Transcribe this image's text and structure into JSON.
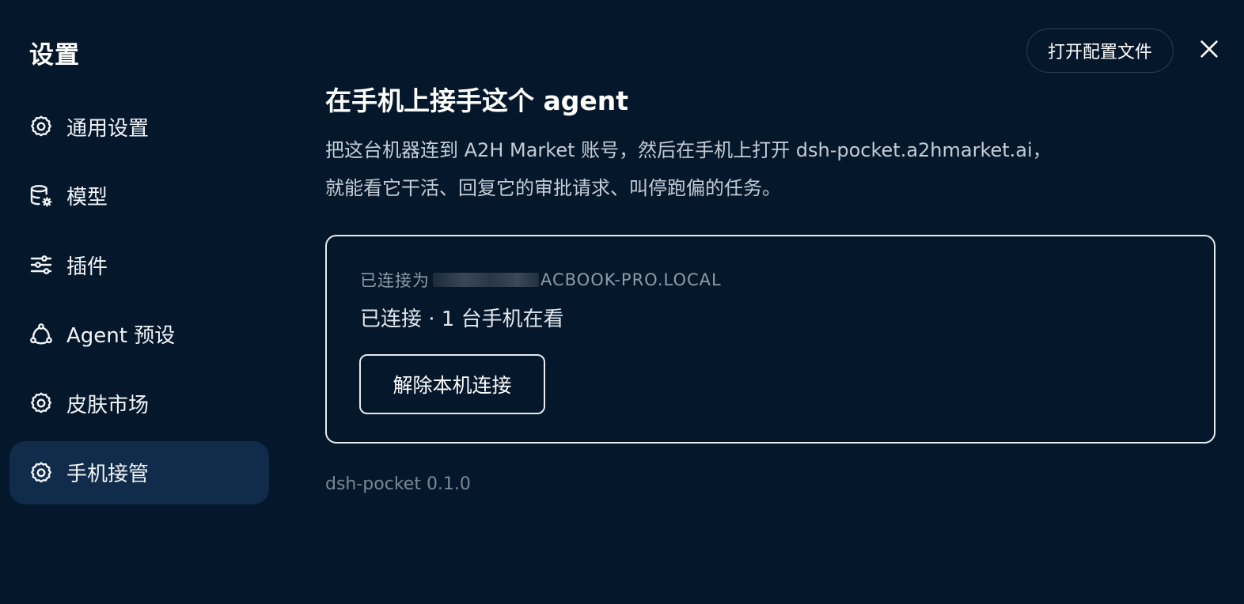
{
  "sidebar": {
    "title": "设置",
    "items": [
      {
        "label": "通用设置",
        "icon": "gear-icon",
        "active": false
      },
      {
        "label": "模型",
        "icon": "database-gear-icon",
        "active": false
      },
      {
        "label": "插件",
        "icon": "sliders-icon",
        "active": false
      },
      {
        "label": "Agent 预设",
        "icon": "agent-nodes-icon",
        "active": false
      },
      {
        "label": "皮肤市场",
        "icon": "gear-icon",
        "active": false
      },
      {
        "label": "手机接管",
        "icon": "gear-icon",
        "active": true
      }
    ]
  },
  "header": {
    "open_config_label": "打开配置文件",
    "close_icon": "close-icon"
  },
  "main": {
    "title": "在手机上接手这个 agent",
    "description_line1": "把这台机器连到 A2H Market 账号，然后在手机上打开 dsh-pocket.a2hmarket.ai，",
    "description_line2": "就能看它干活、回复它的审批请求、叫停跑偏的任务。",
    "card": {
      "connected_as_prefix": "已连接为",
      "connected_as_host": "ACBOOK-PRO.LOCAL",
      "status": "已连接 · 1 台手机在看",
      "disconnect_label": "解除本机连接"
    },
    "version": "dsh-pocket 0.1.0"
  },
  "colors": {
    "background": "#05182b",
    "active_item": "#112c4a",
    "border_light": "#e6ebf0",
    "muted_text": "#8e9aa8"
  }
}
